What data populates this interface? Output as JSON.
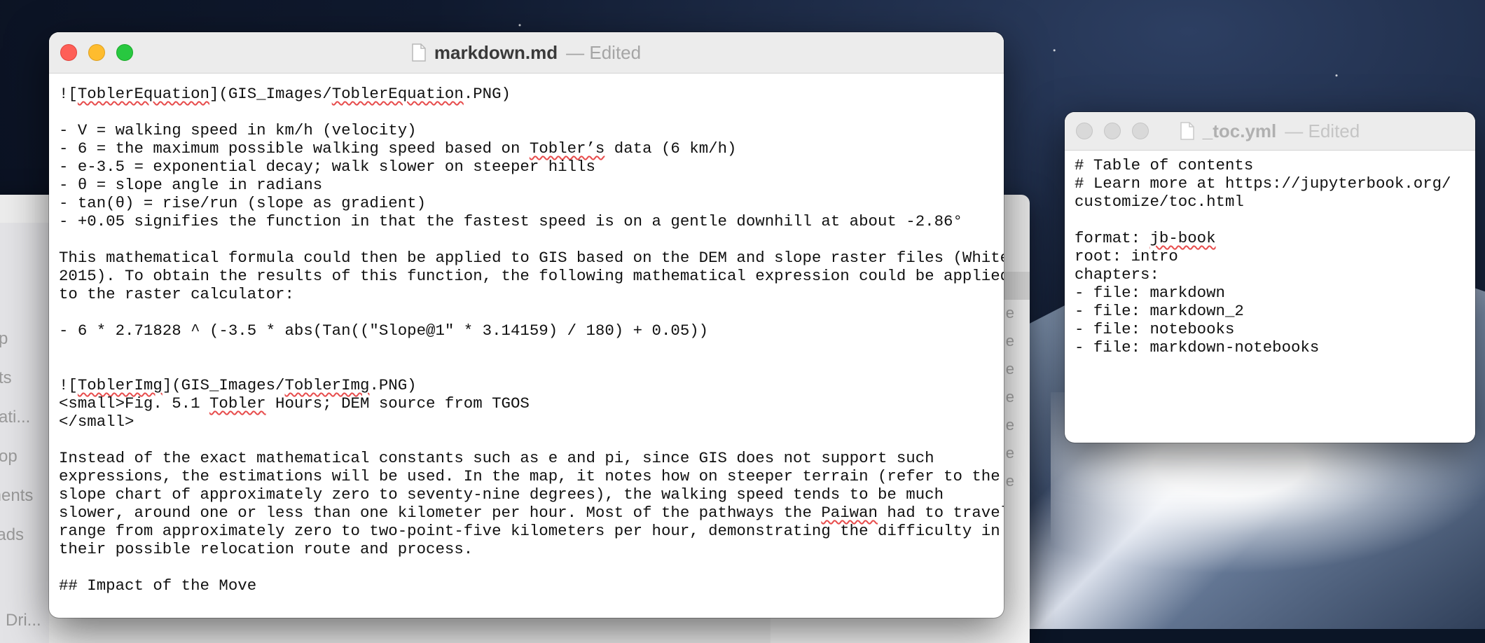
{
  "desktop": {
    "finder_sidebar": [
      "p",
      "ts",
      "ati...",
      "op",
      "ments",
      "oads",
      "Dri..."
    ],
    "finder_list_marker": "e"
  },
  "main_window": {
    "title": "markdown.md",
    "status": "— Edited",
    "colors": {
      "close": "#fe5f57",
      "minimize": "#febc2e",
      "zoom": "#28c840"
    },
    "lines": [
      {
        "segments": [
          {
            "t": "![",
            "s": false
          },
          {
            "t": "ToblerEquation",
            "s": true
          },
          {
            "t": "](GIS_Images/",
            "s": false
          },
          {
            "t": "ToblerEquation",
            "s": true
          },
          {
            "t": ".PNG)",
            "s": false
          }
        ]
      },
      {
        "segments": [
          {
            "t": "",
            "s": false
          }
        ]
      },
      {
        "segments": [
          {
            "t": "- V = walking speed in km/h (velocity)",
            "s": false
          }
        ]
      },
      {
        "segments": [
          {
            "t": "- 6 = the maximum possible walking speed based on ",
            "s": false
          },
          {
            "t": "Tobler’s",
            "s": true
          },
          {
            "t": " data (6 km/h)",
            "s": false
          }
        ]
      },
      {
        "segments": [
          {
            "t": "- e-3.5 = exponential decay; walk slower on steeper hills",
            "s": false
          }
        ]
      },
      {
        "segments": [
          {
            "t": "- θ = slope angle in radians",
            "s": false
          }
        ]
      },
      {
        "segments": [
          {
            "t": "- tan(θ) = rise/run (slope as gradient)",
            "s": false
          }
        ]
      },
      {
        "segments": [
          {
            "t": "- +0.05 signifies the function in that the fastest speed is on a gentle downhill at about -2.86°",
            "s": false
          }
        ]
      },
      {
        "segments": [
          {
            "t": "",
            "s": false
          }
        ]
      },
      {
        "segments": [
          {
            "t": "This mathematical formula could then be applied to GIS based on the DEM and slope raster files (White",
            "s": false
          }
        ]
      },
      {
        "segments": [
          {
            "t": "2015). To obtain the results of this function, the following mathematical expression could be applied",
            "s": false
          }
        ]
      },
      {
        "segments": [
          {
            "t": "to the raster calculator:",
            "s": false
          }
        ]
      },
      {
        "segments": [
          {
            "t": "",
            "s": false
          }
        ]
      },
      {
        "segments": [
          {
            "t": "- 6 * 2.71828 ^ (-3.5 * abs(Tan((\"Slope@1\" * 3.14159) / 180) + 0.05))",
            "s": false
          }
        ]
      },
      {
        "segments": [
          {
            "t": "",
            "s": false
          }
        ]
      },
      {
        "segments": [
          {
            "t": "",
            "s": false
          }
        ]
      },
      {
        "segments": [
          {
            "t": "![",
            "s": false
          },
          {
            "t": "ToblerImg",
            "s": true
          },
          {
            "t": "](GIS_Images/",
            "s": false
          },
          {
            "t": "ToblerImg",
            "s": true
          },
          {
            "t": ".PNG)",
            "s": false
          }
        ]
      },
      {
        "segments": [
          {
            "t": "<small>Fig. 5.1 ",
            "s": false
          },
          {
            "t": "Tobler",
            "s": true
          },
          {
            "t": " Hours; DEM source from TGOS",
            "s": false
          }
        ]
      },
      {
        "segments": [
          {
            "t": "</small>",
            "s": false
          }
        ]
      },
      {
        "segments": [
          {
            "t": "",
            "s": false
          }
        ]
      },
      {
        "segments": [
          {
            "t": "Instead of the exact mathematical constants such as e and pi, since GIS does not support such",
            "s": false
          }
        ]
      },
      {
        "segments": [
          {
            "t": "expressions, the estimations will be used. In the map, it notes how on steeper terrain (refer to the",
            "s": false
          }
        ]
      },
      {
        "segments": [
          {
            "t": "slope chart of approximately zero to seventy-nine degrees), the walking speed tends to be much",
            "s": false
          }
        ]
      },
      {
        "segments": [
          {
            "t": "slower, around one or less than one kilometer per hour. Most of the pathways the ",
            "s": false
          },
          {
            "t": "Paiwan",
            "s": true
          },
          {
            "t": " had to travel",
            "s": false
          }
        ]
      },
      {
        "segments": [
          {
            "t": "range from approximately zero to two-point-five kilometers per hour, demonstrating the difficulty in",
            "s": false
          }
        ]
      },
      {
        "segments": [
          {
            "t": "their possible relocation route and process.",
            "s": false
          }
        ]
      },
      {
        "segments": [
          {
            "t": "",
            "s": false
          }
        ]
      },
      {
        "segments": [
          {
            "t": "## Impact of the Move",
            "s": false
          }
        ]
      }
    ]
  },
  "toc_window": {
    "title": "_toc.yml",
    "status": "— Edited",
    "lines": [
      {
        "segments": [
          {
            "t": "# Table of contents",
            "s": false
          }
        ]
      },
      {
        "segments": [
          {
            "t": "# Learn more at https://jupyterbook.org/",
            "s": false
          }
        ]
      },
      {
        "segments": [
          {
            "t": "customize/toc.html",
            "s": false
          }
        ]
      },
      {
        "segments": [
          {
            "t": "",
            "s": false
          }
        ]
      },
      {
        "segments": [
          {
            "t": "format: ",
            "s": false
          },
          {
            "t": "jb-book",
            "s": true
          }
        ]
      },
      {
        "segments": [
          {
            "t": "root: intro",
            "s": false
          }
        ]
      },
      {
        "segments": [
          {
            "t": "chapters:",
            "s": false
          }
        ]
      },
      {
        "segments": [
          {
            "t": "- file: markdown",
            "s": false
          }
        ]
      },
      {
        "segments": [
          {
            "t": "- file: markdown_2",
            "s": false
          }
        ]
      },
      {
        "segments": [
          {
            "t": "- file: notebooks",
            "s": false
          }
        ]
      },
      {
        "segments": [
          {
            "t": "- file: markdown-notebooks",
            "s": false
          }
        ]
      }
    ]
  }
}
